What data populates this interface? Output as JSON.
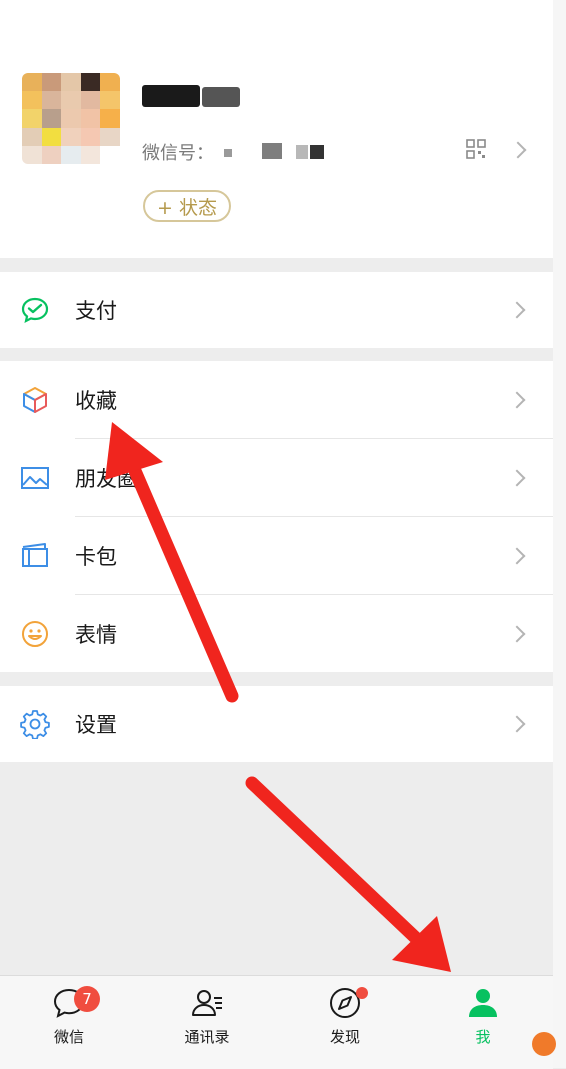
{
  "profile": {
    "wechat_id_label": "微信号：",
    "status_button_label": "+ 状态"
  },
  "menu": {
    "pay": {
      "label": "支付",
      "icon": "wechat-pay-icon"
    },
    "favorites": {
      "label": "收藏",
      "icon": "cube-icon"
    },
    "moments": {
      "label": "朋友圈",
      "icon": "picture-icon"
    },
    "cards": {
      "label": "卡包",
      "icon": "card-wallet-icon"
    },
    "stickers": {
      "label": "表情",
      "icon": "smiley-icon"
    },
    "settings": {
      "label": "设置",
      "icon": "gear-icon"
    }
  },
  "tabbar": {
    "items": [
      {
        "label": "微信",
        "icon": "chat-bubble-icon",
        "badge": "7"
      },
      {
        "label": "通讯录",
        "icon": "contacts-icon"
      },
      {
        "label": "发现",
        "icon": "compass-icon",
        "has_dot": true
      },
      {
        "label": "我",
        "icon": "person-icon",
        "active": true
      }
    ]
  },
  "colors": {
    "accent_green": "#07c160",
    "badge_red": "#f04d3f",
    "annotation_arrow": "#f0251e",
    "status_gold": "#b59a4d"
  }
}
